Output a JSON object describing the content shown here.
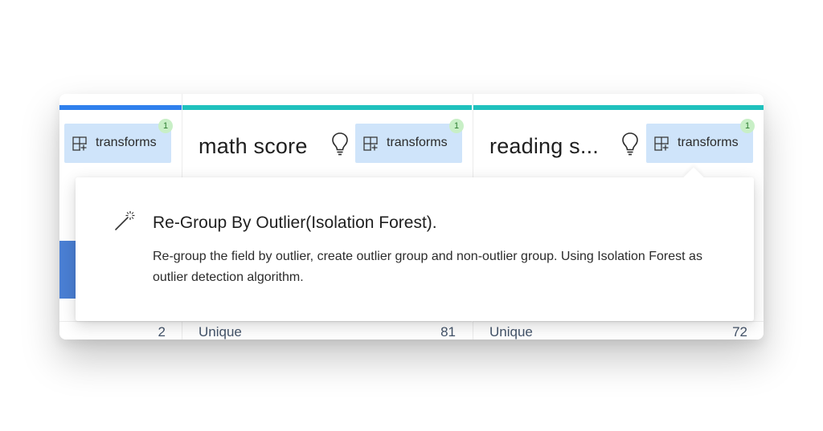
{
  "columns": [
    {
      "title": "",
      "transforms_label": "transforms",
      "badge_count": "1",
      "stat_label": "",
      "stat_value": "2"
    },
    {
      "title": "math score",
      "transforms_label": "transforms",
      "badge_count": "1",
      "stat_label": "Unique",
      "stat_value": "81"
    },
    {
      "title": "reading s...",
      "transforms_label": "transforms",
      "badge_count": "1",
      "stat_label": "Unique",
      "stat_value": "72"
    }
  ],
  "popup": {
    "icon": "magic-wand-icon",
    "title": "Re-Group By Outlier(Isolation Forest).",
    "description": "Re-group the field by outlier, create outlier group and non-outlier group. Using Isolation Forest as outlier detection algorithm."
  },
  "colors": {
    "measure_bar": "#2f80ed",
    "dimension_bar": "#1fc1bd",
    "transforms_button_bg": "#cfe4fa",
    "badge_bg": "#c8efc6",
    "distribution_bar": "#4a7fd4"
  }
}
